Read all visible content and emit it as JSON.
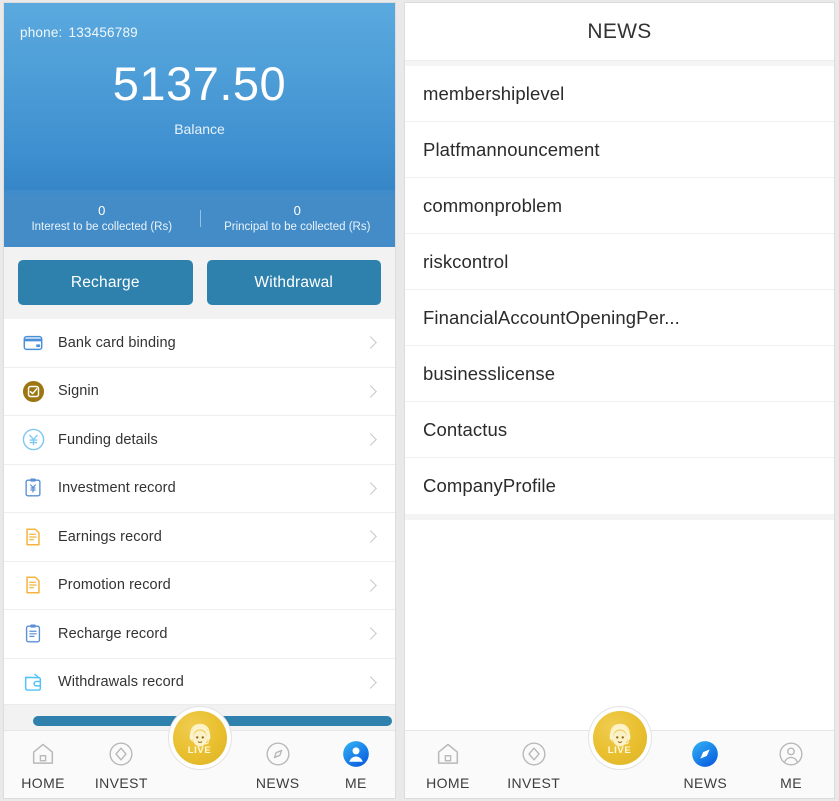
{
  "left_panel": {
    "account": {
      "phone_label": "phone:",
      "phone_value": "133456789",
      "balance_amount": "5137.50",
      "balance_caption": "Balance",
      "pending": [
        {
          "value": "0",
          "label": "Interest to be collected (Rs)"
        },
        {
          "value": "0",
          "label": "Principal to be collected (Rs)"
        }
      ]
    },
    "actions": [
      {
        "label": "Recharge",
        "icon": "recharge-action"
      },
      {
        "label": "Withdrawal",
        "icon": "withdrawal-action"
      }
    ],
    "menu": [
      {
        "label": "Bank card binding",
        "icon": "bank-card-icon"
      },
      {
        "label": "Signin",
        "icon": "checkbox-circle-icon"
      },
      {
        "label": "Funding details",
        "icon": "yen-circle-icon"
      },
      {
        "label": "Investment record",
        "icon": "clipboard-yen-icon"
      },
      {
        "label": "Earnings record",
        "icon": "document-orange-icon"
      },
      {
        "label": "Promotion record",
        "icon": "document-orange-icon"
      },
      {
        "label": "Recharge record",
        "icon": "clipboard-blue-icon"
      },
      {
        "label": "Withdrawals record",
        "icon": "wallet-icon"
      }
    ]
  },
  "right_panel": {
    "header_title": "NEWS",
    "news_items": [
      {
        "label": "membershiplevel"
      },
      {
        "label": "Platfmannouncement"
      },
      {
        "label": "commonproblem"
      },
      {
        "label": "riskcontrol"
      },
      {
        "label": "FinancialAccountOpeningPer..."
      },
      {
        "label": "businesslicense"
      },
      {
        "label": "Contactus"
      },
      {
        "label": "CompanyProfile"
      }
    ]
  },
  "tabbar": {
    "items": [
      {
        "label": "HOME",
        "icon": "home-icon"
      },
      {
        "label": "INVEST",
        "icon": "diamond-circle-icon"
      },
      {
        "label": "",
        "icon": "live-support-icon"
      },
      {
        "label": "NEWS",
        "icon": "compass-icon"
      },
      {
        "label": "ME",
        "icon": "person-icon"
      }
    ],
    "live_label": "LIVE",
    "left_active": "ME",
    "right_active": "NEWS"
  },
  "colors": {
    "brand_blue": "#2e81ad",
    "card_blue_top": "#5aa9de",
    "card_blue_bottom": "#3a86c4",
    "accent_gold": "#e9bf2e",
    "active_blue": "#0f83e8",
    "icon_orange": "#f5a623",
    "icon_cyan": "#4fc3f7"
  }
}
